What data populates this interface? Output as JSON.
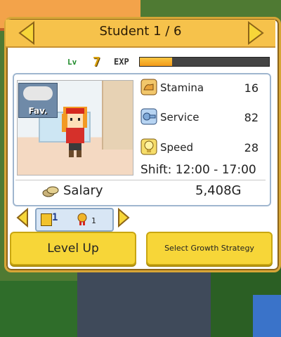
{
  "header": {
    "title": "Student 1 / 6"
  },
  "level": {
    "label": "Lv",
    "value": "7",
    "exp_label": "EXP",
    "exp_progress": 0.25
  },
  "portrait": {
    "fav_label": "Fav."
  },
  "stats": [
    {
      "label": "Stamina",
      "value": "16",
      "icon": "stamina-icon"
    },
    {
      "label": "Service",
      "value": "82",
      "icon": "service-icon"
    },
    {
      "label": "Speed",
      "value": "28",
      "icon": "speed-icon"
    }
  ],
  "shift": "Shift: 12:00 - 17:00",
  "salary": {
    "label": "Salary",
    "value": "5,408G"
  },
  "items": {
    "ticket_count": "1",
    "medal_count": "1"
  },
  "buttons": {
    "level_up": "Level Up",
    "growth": "Select Growth Strategy"
  },
  "colors": {
    "accent": "#f6c24b",
    "button": "#f7d638",
    "exp_fill": "#f39a1a"
  }
}
